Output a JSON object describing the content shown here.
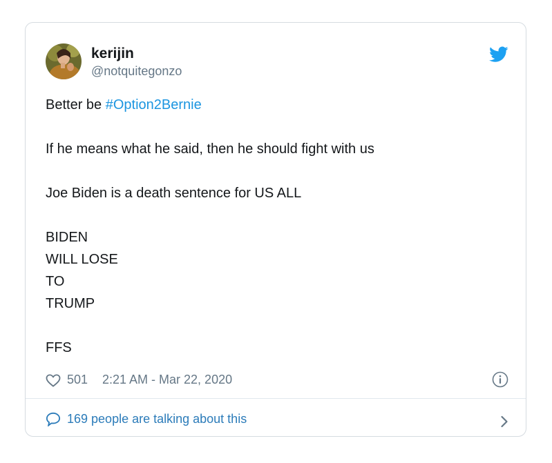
{
  "tweet": {
    "display_name": "kerijin",
    "handle": "@notquitegonzo",
    "line1_prefix": "Better be ",
    "line1_hashtag": "#Option2Bernie",
    "line2": "If he means what he said, then he should fight with us",
    "line3": "Joe Biden is a death sentence for US ALL",
    "line4": "BIDEN",
    "line5": "WILL LOSE",
    "line6": "TO",
    "line7": "TRUMP",
    "line8": "FFS"
  },
  "meta": {
    "likes": "501",
    "timestamp": "2:21 AM - Mar 22, 2020"
  },
  "footer": {
    "talking": "169 people are talking about this"
  },
  "icons": {
    "brand": "twitter-bird-icon",
    "like": "heart-icon",
    "info": "info-icon",
    "reply": "speech-bubble-icon",
    "chevron": "chevron-right-icon"
  },
  "colors": {
    "brand": "#1da1f2",
    "link": "#1b95e0",
    "muted": "#657786",
    "footer_link": "#2b7bb9"
  }
}
